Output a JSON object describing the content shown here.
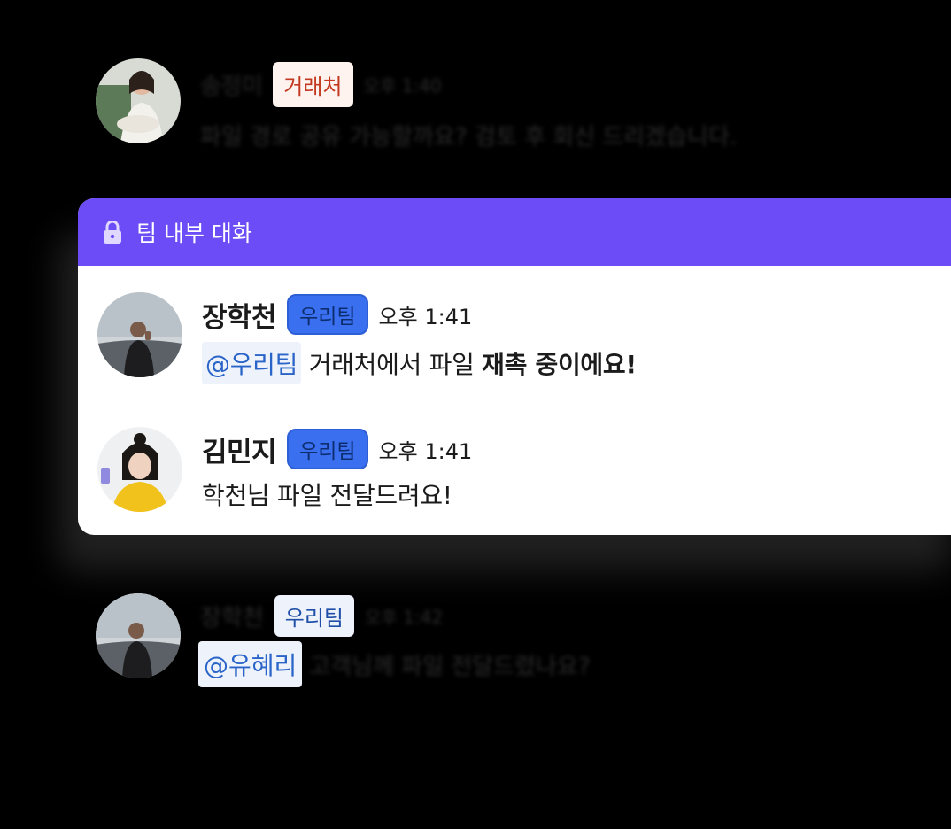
{
  "header": {
    "title": "팀 내부 대화",
    "icon": "lock-icon"
  },
  "colors": {
    "header_bg": "#6b4cf6",
    "team_badge": "#3a6ff0",
    "partner_badge_text": "#c3391f",
    "mention_text": "#2a64c8"
  },
  "top_message": {
    "author": "송정미",
    "badge": "거래처",
    "time": "오후 1:40",
    "text": "파일 경로 공유 가능할까요? 검토 후 회신 드리겠습니다."
  },
  "messages": [
    {
      "author": "장학천",
      "badge": "우리팀",
      "time": "오후 1:41",
      "mention": "@우리팀",
      "text_plain": "거래처에서 파일",
      "text_bold": "재촉 중이에요!"
    },
    {
      "author": "김민지",
      "badge": "우리팀",
      "time": "오후 1:41",
      "text": "학천님 파일 전달드려요!"
    }
  ],
  "bottom_message": {
    "author": "장학천",
    "badge": "우리팀",
    "time": "오후 1:42",
    "mention": "@유혜리",
    "text": "고객님께 파일 전달드렸나요?"
  }
}
